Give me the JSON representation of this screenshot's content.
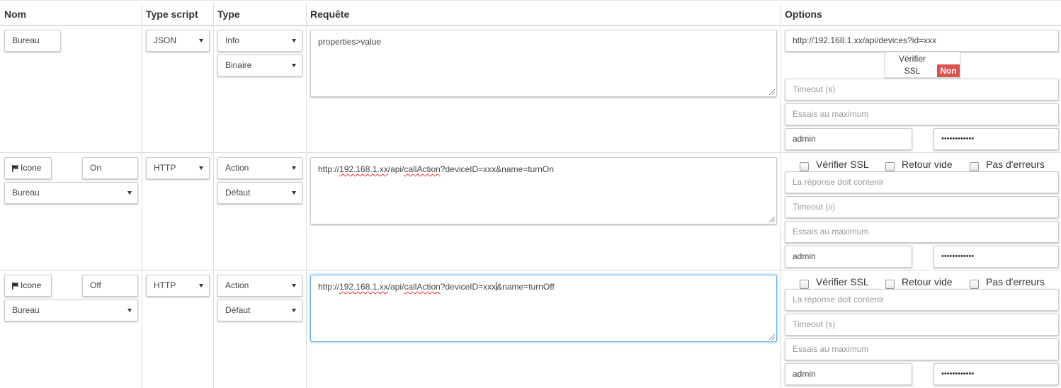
{
  "headers": {
    "nom": "Nom",
    "type_script": "Type script",
    "type": "Type",
    "requete": "Requête",
    "options": "Options"
  },
  "rows": [
    {
      "name": "Bureau",
      "script": "JSON",
      "type": "Info",
      "subtype": "Binaire",
      "request": "properties>value",
      "url": "http://192.168.1.xx/api/devices?id=xxx",
      "ssl_toggle": {
        "label1": "Vérifier",
        "label2": "SSL",
        "state": "Non"
      },
      "timeout_placeholder": "Timeout (s)",
      "retries_placeholder": "Essais au maximum",
      "username": "admin",
      "password": "••••••••••••"
    },
    {
      "icon_button": "Icone",
      "name": "On",
      "object": "Bureau",
      "script": "HTTP",
      "type": "Action",
      "subtype": "Défaut",
      "request": {
        "p1": "http://",
        "p2": "192.168.1.xx",
        "p3": "/api/",
        "p4": "callAction",
        "p5": "?deviceID=xxx&name=turnOn"
      },
      "checkboxes": {
        "ssl": "Vérifier SSL",
        "empty": "Retour vide",
        "no_errors": "Pas d'erreurs"
      },
      "response_placeholder": "La réponse doit contenir",
      "timeout_placeholder": "Timeout (s)",
      "retries_placeholder": "Essais au maximum",
      "username": "admin",
      "password": "••••••••••••"
    },
    {
      "icon_button": "Icone",
      "name": "Off",
      "object": "Bureau",
      "script": "HTTP",
      "type": "Action",
      "subtype": "Défaut",
      "request": {
        "p1": "http://",
        "p2": "192.168.1.xx",
        "p3": "/api/",
        "p4": "callAction",
        "p5a": "?deviceID=xxx",
        "p5b": "&name=turnOff"
      },
      "checkboxes": {
        "ssl": "Vérifier SSL",
        "empty": "Retour vide",
        "no_errors": "Pas d'erreurs"
      },
      "response_placeholder": "La réponse doit contenir",
      "timeout_placeholder": "Timeout (s)",
      "retries_placeholder": "Essais au maximum",
      "username": "admin",
      "password": "••••••••••••"
    }
  ]
}
